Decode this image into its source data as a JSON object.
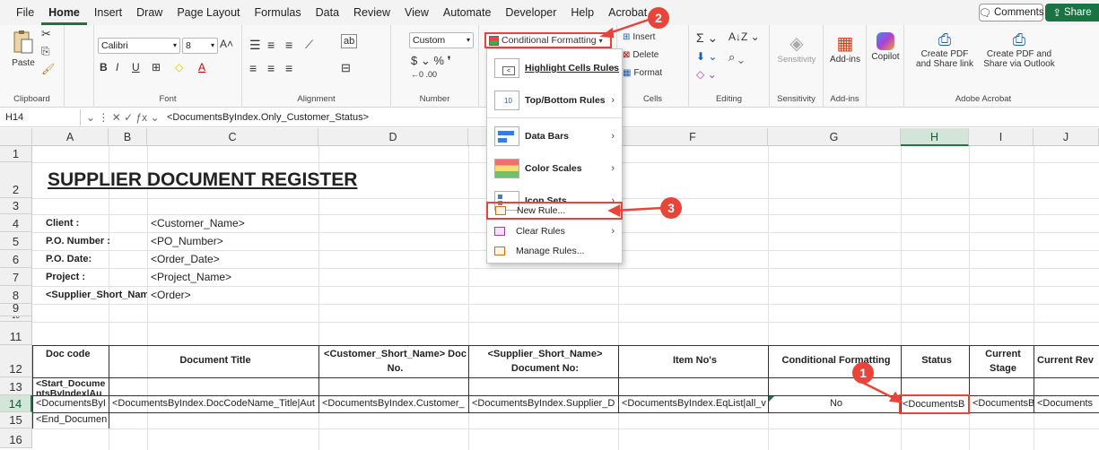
{
  "menu": {
    "tabs": [
      "File",
      "Home",
      "Insert",
      "Draw",
      "Page Layout",
      "Formulas",
      "Data",
      "Review",
      "View",
      "Automate",
      "Developer",
      "Help",
      "Acrobat"
    ],
    "active": "Home"
  },
  "topright": {
    "comments": "Comments",
    "share": "Share"
  },
  "ribbon": {
    "paste": "Paste",
    "groups": [
      "Clipboard",
      "Font",
      "Alignment",
      "Number",
      "Cells",
      "Editing",
      "Sensitivity",
      "Add-ins",
      "Adobe Acrobat"
    ],
    "font_name": "Calibri",
    "font_size": "8",
    "number_format": "Custom",
    "cf_button": "Conditional Formatting",
    "insert": "Insert",
    "delete": "Delete",
    "format": "Format",
    "sensitivity": "Sensitivity",
    "addins": "Add-ins",
    "copilot": "Copilot",
    "create_pdf": "Create PDF",
    "create_pdf_2": "and Share link",
    "create_pdf_outlook": "Create PDF and",
    "create_pdf_outlook_2": "Share via Outlook"
  },
  "formula_bar": {
    "namebox": "H14",
    "formula": "<DocumentsByIndex.Only_Customer_Status>"
  },
  "columns": [
    "A",
    "B",
    "C",
    "D",
    "E",
    "F",
    "G",
    "H",
    "I",
    "J"
  ],
  "selected_column": "H",
  "rows": [
    "1",
    "2",
    "3",
    "4",
    "5",
    "6",
    "7",
    "8",
    "9",
    "10",
    "11",
    "12",
    "13",
    "14",
    "15",
    "16"
  ],
  "selected_row": "14",
  "sheet": {
    "title": "SUPPLIER DOCUMENT REGISTER",
    "labels": {
      "client": "Client :",
      "client_val": "<Customer_Name>",
      "po_number": "P.O. Number :",
      "po_number_val": "<PO_Number>",
      "po_date": "P.O. Date:",
      "po_date_val": "<Order_Date>",
      "project": "Project :",
      "project_val": "<Project_Name>",
      "supplier": "<Supplier_Short_Name>",
      "supplier_val": "<Order>"
    },
    "headers": {
      "doc_code": "Doc code",
      "doc_title": "Document Title",
      "cust_doc_1": "<Customer_Short_Name> Doc",
      "cust_doc_2": "No.",
      "supp_doc_1": "<Supplier_Short_Name>",
      "supp_doc_2": "Document No:",
      "item_nos": "Item No's",
      "cond_fmt": "Conditional Formatting",
      "status": "Status",
      "current_stage_1": "Current",
      "current_stage_2": "Stage",
      "current_rev": "Current Rev"
    },
    "row13": {
      "a1": "<Start_Docume",
      "a2": "ntsByIndex|Au"
    },
    "row14": {
      "a": "<DocumentsByI",
      "c": "<DocumentsByIndex.DocCodeName_Title|Aut",
      "d": "<DocumentsByIndex.Customer_",
      "e": "<DocumentsByIndex.Supplier_D",
      "f": "<DocumentsByIndex.EqList|all_v",
      "g": "No",
      "h": "<DocumentsB",
      "i": "<DocumentsB",
      "j": "<Documents"
    },
    "row15": {
      "a": "<End_Documen"
    }
  },
  "cf_menu": {
    "highlight": "Highlight Cells Rules",
    "topbottom": "Top/Bottom Rules",
    "databars": "Data Bars",
    "colorscales": "Color Scales",
    "iconsets": "Icon Sets",
    "newrule": "New Rule...",
    "clearrules": "Clear Rules",
    "managerules": "Manage Rules..."
  },
  "callouts": [
    "1",
    "2",
    "3"
  ],
  "colors": {
    "accent": "#217346",
    "callout": "#e8443a"
  }
}
